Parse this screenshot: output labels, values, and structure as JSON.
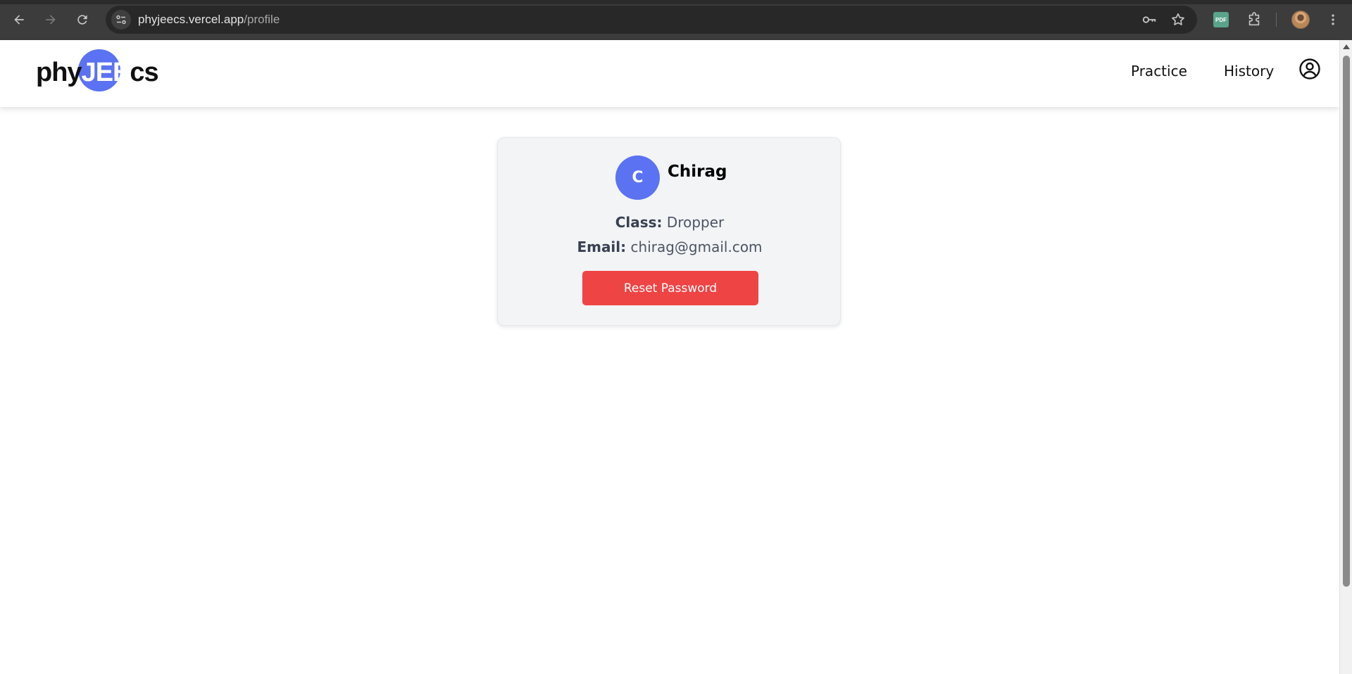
{
  "browser": {
    "url_host": "phyjeecs.vercel.app",
    "url_path": "/profile",
    "extension_label": "PDF",
    "icons": [
      "back-arrow-icon",
      "forward-arrow-icon",
      "reload-icon",
      "site-info-icon",
      "key-icon",
      "star-icon",
      "pdf-extension-icon",
      "puzzle-extension-icon",
      "profile-avatar-icon",
      "kebab-menu-icon"
    ]
  },
  "header": {
    "logo": {
      "part1": "phy",
      "part2": "JEE",
      "part3": "cs"
    },
    "nav": {
      "practice": "Practice",
      "history": "History"
    },
    "user_icon": "user-circle-icon"
  },
  "profile": {
    "initial": "C",
    "name": "Chirag",
    "class_label": "Class:",
    "class_value": "Dropper",
    "email_label": "Email:",
    "email_value": "chirag@gmail.com",
    "reset_button": "Reset Password"
  },
  "colors": {
    "brand": "#5b72f2",
    "danger": "#ef4444",
    "card_bg": "#f3f4f6",
    "chrome_bg": "#3c3c3c",
    "omnibox_bg": "#282828"
  }
}
